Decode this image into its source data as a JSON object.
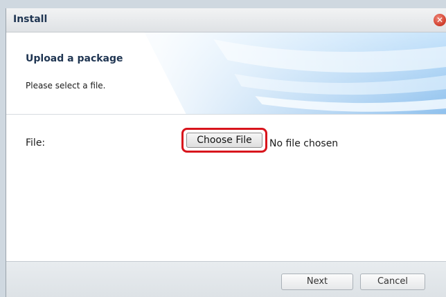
{
  "window": {
    "title": "Install",
    "close_glyph": "✕"
  },
  "header": {
    "title": "Upload a package",
    "subtitle": "Please select a file."
  },
  "form": {
    "file_label": "File:",
    "choose_file_label": "Choose File",
    "file_status": "No file chosen"
  },
  "footer": {
    "next_label": "Next",
    "cancel_label": "Cancel"
  },
  "colors": {
    "title_text": "#1f3552",
    "highlight_border": "#d8141c",
    "close_button": "#d2412f",
    "header_accent": "#8fc3ee"
  },
  "icons": {
    "close": "close-icon"
  }
}
